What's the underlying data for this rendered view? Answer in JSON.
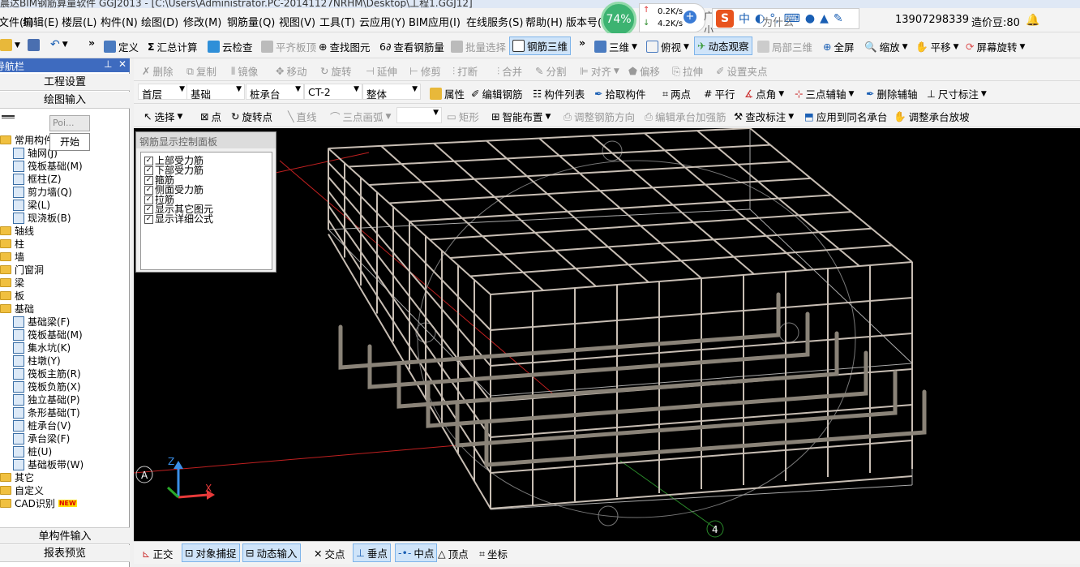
{
  "title": "晨达BIM钢筋算量软件 GGJ2013 - [C:\\Users\\Administrator.PC-20141127NRHM\\Desktop\\工程1.GGJ12]",
  "menu": [
    "文件(F)",
    "编辑(E)",
    "楼层(L)",
    "构件(N)",
    "绘图(D)",
    "修改(M)",
    "钢筋量(Q)",
    "视图(V)",
    "工具(T)",
    "云应用(Y)",
    "BIM应用(I)",
    "在线服务(S)",
    "帮助(H)",
    "版本号(B)"
  ],
  "net": {
    "percent": "74%",
    "up": "0.2K/s",
    "down": "4.2K/s"
  },
  "account": {
    "phone": "13907298339",
    "beans": "造价豆:80",
    "extra1": "广小二",
    "extra2": "为什么"
  },
  "toolbar1": {
    "define": "定义",
    "sum": "汇总计算",
    "cloud_check": "云检查",
    "flat_top": "平齐板顶",
    "find": "查找图元",
    "view_rebar": "查看钢筋量",
    "batch": "批量选择",
    "rebar3d": "钢筋三维",
    "view3d": "三维",
    "top_view": "俯视",
    "dynamic": "动态观察",
    "local3d": "局部三维",
    "fullscreen": "全屏",
    "zoom": "缩放",
    "pan": "平移",
    "rotate": "屏幕旋转"
  },
  "toolbar2": {
    "delete": "删除",
    "copy": "复制",
    "mirror": "镜像",
    "move": "移动",
    "rotate": "旋转",
    "extend": "延伸",
    "trim": "修剪",
    "break": "打断",
    "merge": "合并",
    "split": "分割",
    "align": "对齐",
    "offset": "偏移",
    "stretch": "拉伸",
    "grip": "设置夹点"
  },
  "toolbar3": {
    "floor": "首层",
    "category": "基础",
    "type": "桩承台",
    "name": "CT-2",
    "scope": "整体",
    "props": "属性",
    "edit_rebar": "编辑钢筋",
    "comp_list": "构件列表",
    "pick": "拾取构件",
    "two_pt": "两点",
    "parallel": "平行",
    "pt_angle": "点角",
    "three_pt_axis": "三点辅轴",
    "del_axis": "删除辅轴",
    "dim": "尺寸标注"
  },
  "toolbar4": {
    "select": "选择",
    "point": "点",
    "rot_point": "旋转点",
    "line": "直线",
    "arc": "三点画弧",
    "rect": "矩形",
    "smart": "智能布置",
    "adj_dir": "调整钢筋方向",
    "edit_reinf": "编辑承台加强筋",
    "mark": "查改标注",
    "apply_same": "应用到同名承台",
    "adj_slope": "调整承台放坡"
  },
  "sidebar": {
    "title": "导航栏",
    "top_buttons": [
      "工程设置",
      "绘图输入"
    ],
    "popup_title": "Poi...",
    "popup_button": "开始",
    "bottom_buttons": [
      "单构件输入",
      "报表预览"
    ],
    "tree": [
      {
        "label": "常用构件",
        "level": 0,
        "icon": "folder-icon"
      },
      {
        "label": "轴网(J)",
        "level": 1,
        "icon": "axis-grid-icon"
      },
      {
        "label": "筏板基础(M)",
        "level": 1,
        "icon": "raft-foundation-icon"
      },
      {
        "label": "框柱(Z)",
        "level": 1,
        "icon": "column-icon"
      },
      {
        "label": "剪力墙(Q)",
        "level": 1,
        "icon": "shear-wall-icon"
      },
      {
        "label": "梁(L)",
        "level": 1,
        "icon": "beam-icon"
      },
      {
        "label": "现浇板(B)",
        "level": 1,
        "icon": "slab-icon"
      },
      {
        "label": "轴线",
        "level": 0,
        "icon": "folder-icon"
      },
      {
        "label": "柱",
        "level": 0,
        "icon": "folder-icon"
      },
      {
        "label": "墙",
        "level": 0,
        "icon": "folder-icon"
      },
      {
        "label": "门窗洞",
        "level": 0,
        "icon": "folder-icon"
      },
      {
        "label": "梁",
        "level": 0,
        "icon": "folder-icon"
      },
      {
        "label": "板",
        "level": 0,
        "icon": "folder-icon"
      },
      {
        "label": "基础",
        "level": 0,
        "icon": "folder-icon"
      },
      {
        "label": "基础梁(F)",
        "level": 1,
        "icon": "foundation-beam-icon"
      },
      {
        "label": "筏板基础(M)",
        "level": 1,
        "icon": "raft-foundation-icon"
      },
      {
        "label": "集水坑(K)",
        "level": 1,
        "icon": "sump-icon"
      },
      {
        "label": "柱墩(Y)",
        "level": 1,
        "icon": "column-pier-icon"
      },
      {
        "label": "筏板主筋(R)",
        "level": 1,
        "icon": "raft-main-rebar-icon"
      },
      {
        "label": "筏板负筋(X)",
        "level": 1,
        "icon": "raft-neg-rebar-icon"
      },
      {
        "label": "独立基础(P)",
        "level": 1,
        "icon": "isolated-footing-icon"
      },
      {
        "label": "条形基础(T)",
        "level": 1,
        "icon": "strip-footing-icon"
      },
      {
        "label": "桩承台(V)",
        "level": 1,
        "icon": "pile-cap-icon"
      },
      {
        "label": "承台梁(F)",
        "level": 1,
        "icon": "cap-beam-icon"
      },
      {
        "label": "桩(U)",
        "level": 1,
        "icon": "pile-icon"
      },
      {
        "label": "基础板带(W)",
        "level": 1,
        "icon": "foundation-strip-icon"
      },
      {
        "label": "其它",
        "level": 0,
        "icon": "folder-icon"
      },
      {
        "label": "自定义",
        "level": 0,
        "icon": "folder-icon"
      },
      {
        "label": "CAD识别",
        "level": 0,
        "icon": "folder-icon",
        "badge": "NEW"
      }
    ]
  },
  "panel": {
    "title": "钢筋显示控制面板",
    "items": [
      "上部受力筋",
      "下部受力筋",
      "箍筋",
      "侧面受力筋",
      "拉筋",
      "显示其它图元",
      "显示详细公式"
    ]
  },
  "viewport": {
    "axis_a": "A",
    "axis_4": "4",
    "axis_z": "Z",
    "axis_x": "X"
  },
  "status": {
    "ortho": "正交",
    "snap": "对象捕捉",
    "dyn_input": "动态输入",
    "intersect": "交点",
    "perp": "垂点",
    "mid": "中点",
    "vertex": "顶点",
    "coord": "坐标"
  }
}
